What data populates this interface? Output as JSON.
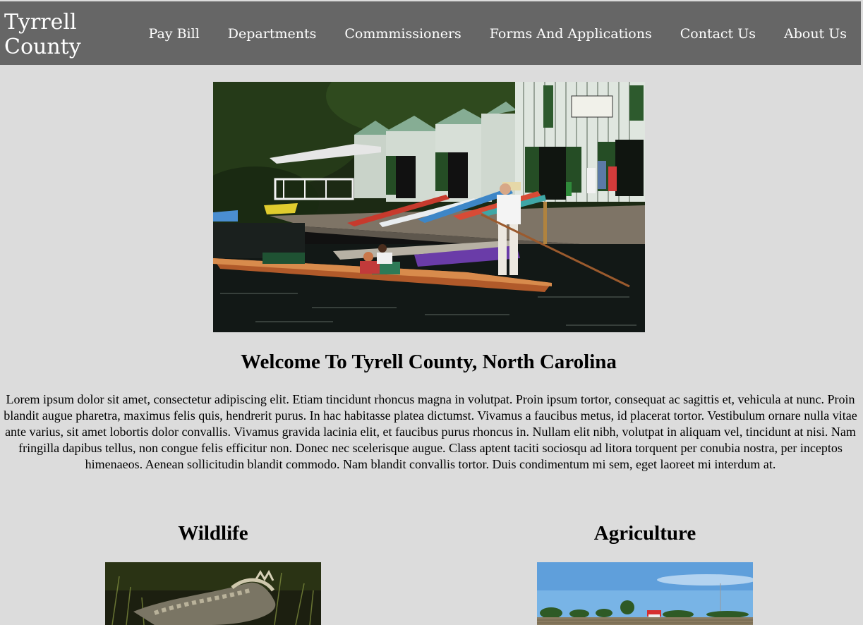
{
  "header": {
    "brand": "Tyrrell County",
    "nav": [
      {
        "label": "Pay Bill"
      },
      {
        "label": "Departments"
      },
      {
        "label": "Commmissioners"
      },
      {
        "label": "Forms And Applications"
      },
      {
        "label": "Contact Us"
      },
      {
        "label": "About Us"
      }
    ]
  },
  "main": {
    "hero_image": "punting-boats-photo",
    "welcome_title": "Welcome To Tyrell County, North Carolina",
    "intro_text": "Lorem ipsum dolor sit amet, consectetur adipiscing elit. Etiam tincidunt rhoncus magna in volutpat. Proin ipsum tortor, consequat ac sagittis et, vehicula at nunc. Proin blandit augue pharetra, maximus felis quis, hendrerit purus. In hac habitasse platea dictumst. Vivamus a faucibus metus, id placerat tortor. Vestibulum ornare nulla vitae ante varius, sit amet lobortis dolor convallis. Vivamus gravida lacinia elit, et faucibus purus rhoncus in. Nullam elit nibh, volutpat in aliquam vel, tincidunt at nisi. Nam fringilla dapibus tellus, non congue felis efficitur non. Donec nec scelerisque augue. Class aptent taciti sociosqu ad litora torquent per conubia nostra, per inceptos himenaeos. Aenean sollicitudin blandit commodo. Nam blandit convallis tortor. Duis condimentum mi sem, eget laoreet mi interdum at.",
    "sections": [
      {
        "title": "Wildlife",
        "image": "alligator-photo"
      },
      {
        "title": "Agriculture",
        "image": "farm-field-photo"
      }
    ]
  },
  "colors": {
    "page_bg": "#dcdcdc",
    "header_bg": "#666666",
    "header_text": "#ffffff"
  }
}
